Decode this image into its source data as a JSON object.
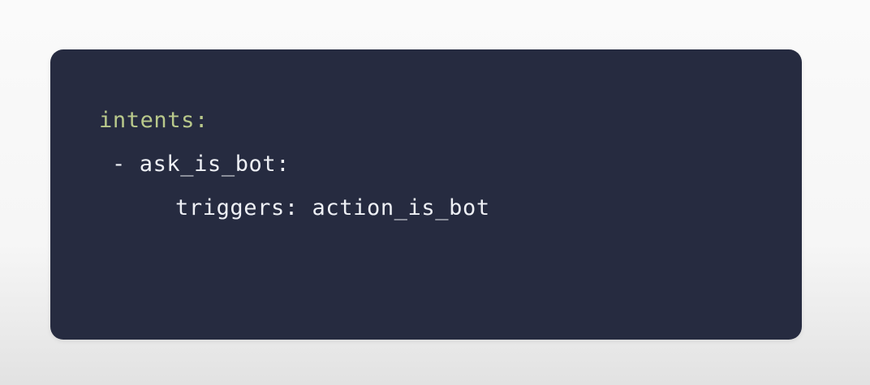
{
  "code_block": {
    "line1": {
      "text": "intents:",
      "color": "#b9c98b"
    },
    "line2": {
      "text": "- ask_is_bot:",
      "color": "#eef0f5"
    },
    "line3": {
      "text": "triggers: action_is_bot",
      "color": "#eef0f5"
    }
  },
  "colors": {
    "card_background": "#262b40",
    "page_background": "#f6f6f6"
  }
}
